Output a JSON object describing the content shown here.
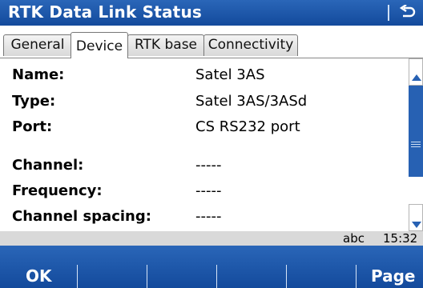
{
  "window": {
    "title": "RTK Data Link Status"
  },
  "tabs": [
    {
      "label": "General",
      "active": false
    },
    {
      "label": "Device",
      "active": true
    },
    {
      "label": "RTK base",
      "active": false
    },
    {
      "label": "Connectivity",
      "active": false
    }
  ],
  "fields": [
    {
      "label": "Name:",
      "value": "Satel 3AS"
    },
    {
      "label": "Type:",
      "value": "Satel 3AS/3ASd"
    },
    {
      "label": "Port:",
      "value": "CS RS232 port"
    },
    {
      "label": "Channel:",
      "value": "-----"
    },
    {
      "label": "Frequency:",
      "value": "-----"
    },
    {
      "label": "Channel spacing:",
      "value": "-----"
    }
  ],
  "status": {
    "input_mode": "abc",
    "time": "15:32"
  },
  "softkeys": {
    "ok": "OK",
    "page": "Page"
  },
  "colors": {
    "accent": "#1f5bab",
    "status_bar": "#d9d9d9"
  },
  "icons": {
    "back": "back-arrow-icon",
    "scroll_up": "chevron-up-icon",
    "scroll_down": "chevron-down-icon"
  }
}
